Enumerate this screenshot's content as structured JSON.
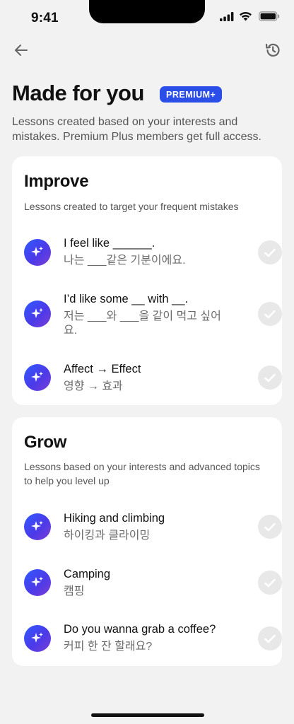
{
  "status_bar": {
    "time": "9:41"
  },
  "header": {
    "title": "Made for you",
    "badge": "PREMIUM+",
    "subtitle": "Lessons created based on your interests and mistakes. Premium Plus members get full access."
  },
  "improve": {
    "title": "Improve",
    "description": "Lessons created to target your frequent mistakes",
    "lessons": [
      {
        "title": "I feel like ______.",
        "subtitle": "나는 ___같은 기분이에요."
      },
      {
        "title": "I’d like some __ with __.",
        "subtitle": "저는 ___와 ___을 같이 먹고 싶어요."
      },
      {
        "title": "Affect → Effect",
        "subtitle": "영향 → 효과"
      }
    ]
  },
  "grow": {
    "title": "Grow",
    "description": "Lessons based on your interests and advanced topics to help you level up",
    "lessons": [
      {
        "title": "Hiking and climbing",
        "subtitle": "하이킹과 클라이밍"
      },
      {
        "title": "Camping",
        "subtitle": "캠핑"
      },
      {
        "title": "Do you wanna grab a coffee?",
        "subtitle": "커피 한 잔 할래요?"
      }
    ]
  },
  "icons": {
    "back": "arrow-left-icon",
    "history": "history-icon",
    "lesson": "sparkle-icon",
    "check": "checkmark-icon"
  },
  "colors": {
    "badge": "#2b4ee8",
    "icon_gradient_start": "#2f5bff",
    "icon_gradient_end": "#7b3fd8",
    "background": "#f2f2f2",
    "card": "#ffffff"
  }
}
